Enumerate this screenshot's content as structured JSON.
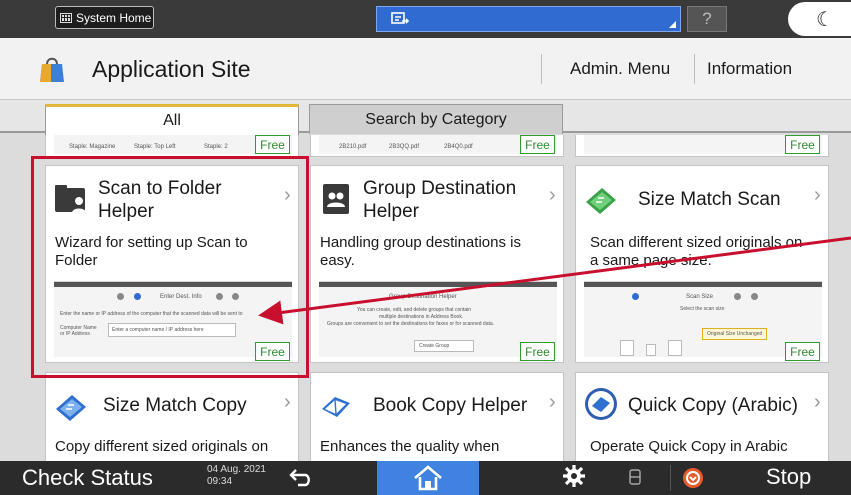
{
  "topbar": {
    "system_home_label": "System Home",
    "help_symbol": "?",
    "night_symbol": "☾",
    "job_icon": "scan-job-icon"
  },
  "header": {
    "title": "Application Site",
    "admin_menu": "Admin. Menu",
    "information": "Information"
  },
  "tabs": [
    {
      "label": "All",
      "active": true
    },
    {
      "label": "Search by Category",
      "active": false
    }
  ],
  "top_row_free": [
    "Free",
    "Free",
    "Free"
  ],
  "top_row_preview_text": [
    "Staple: Magazine",
    "Staple: Top Left",
    "Staple: 2",
    "2B210.pdf",
    "2B3QQ.pdf",
    "2B4Q0.pdf"
  ],
  "cards": [
    {
      "title_line1": "Scan to Folder",
      "title_line2": "Helper",
      "desc_line1": "Wizard for setting up Scan to",
      "desc_line2": "Folder",
      "badge": "Free",
      "icon": "folder-user-icon",
      "preview": {
        "heading": "Enter Dest. Info",
        "text": "Enter the name or IP address of the computer that the scanned data will be sent to",
        "field_label": "Computer Name or IP Address",
        "field_placeholder": "Enter a computer name / IP address here"
      }
    },
    {
      "title_line1": "Group Destination",
      "title_line2": "Helper",
      "desc_line1": "Handling group destinations is",
      "desc_line2": "easy.",
      "badge": "Free",
      "icon": "address-book-group-icon",
      "preview": {
        "heading": "Group Destination Helper",
        "text1": "You can create, edit, and delete groups that contain",
        "text2": "multiple destinations in Address Book.",
        "text3": "Groups are convenient to set the destinations for faxes or for scanned data.",
        "button": "Create Group"
      }
    },
    {
      "title_line1": "Size Match Scan",
      "title_line2": "",
      "desc_line1": "Scan different sized originals on",
      "desc_line2": "a same page size.",
      "badge": "Free",
      "icon": "scan-pages-icon",
      "preview": {
        "heading": "Scan Size",
        "text": "Select the scan size",
        "option": "Original Size Unchanged"
      }
    },
    {
      "title_line1": "Size Match Copy",
      "desc_line1": "Copy different sized originals on",
      "icon": "copy-pages-icon"
    },
    {
      "title_line1": "Book Copy Helper",
      "desc_line1": "Enhances the quality when",
      "icon": "book-icon"
    },
    {
      "title_line1": "Quick Copy (Arabic)",
      "desc_line1": "Operate Quick Copy in Arabic",
      "icon": "quick-copy-icon"
    }
  ],
  "bottombar": {
    "check_status": "Check Status",
    "date": "04 Aug. 2021",
    "time": "09:34",
    "stop": "Stop"
  },
  "colors": {
    "highlight": "#c8102e",
    "accent_blue": "#3f82e0",
    "free_green": "#2f8a2f",
    "tab_accent": "#e1b83b",
    "stop_orange": "#e65a2e"
  }
}
